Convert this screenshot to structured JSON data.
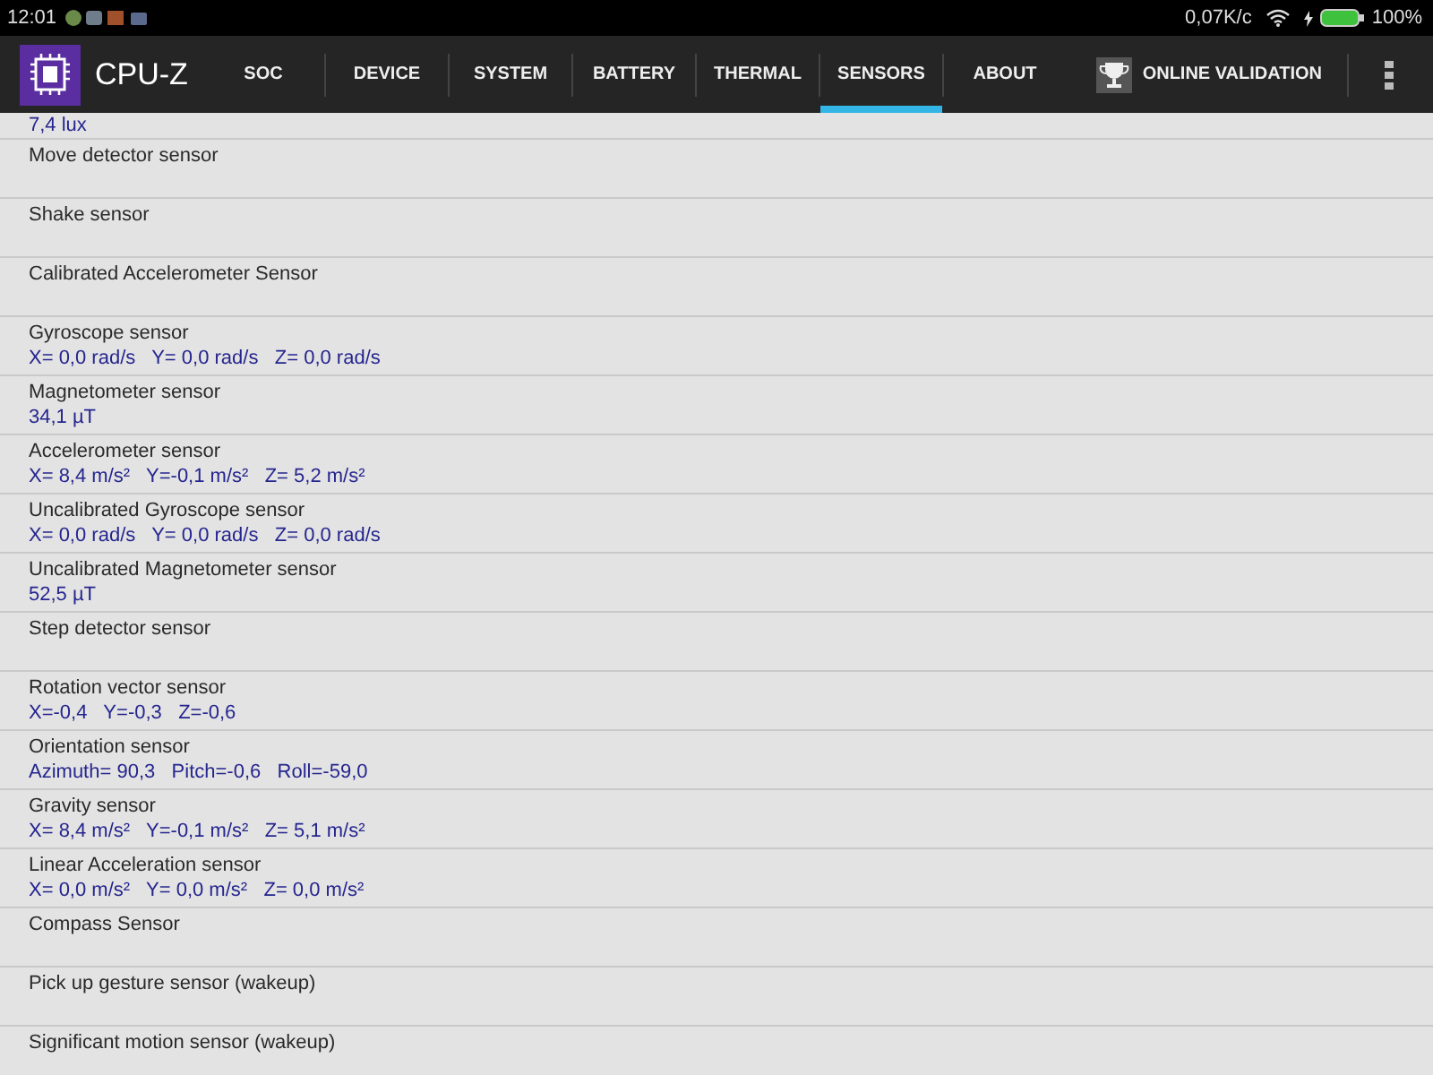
{
  "status_bar": {
    "time": "12:01",
    "speed": "0,07K/c",
    "battery": "100%"
  },
  "app_bar": {
    "title": "CPU-Z",
    "validation": "ONLINE VALIDATION"
  },
  "tabs": [
    {
      "label": "SOC",
      "selected": false
    },
    {
      "label": "DEVICE",
      "selected": false
    },
    {
      "label": "SYSTEM",
      "selected": false
    },
    {
      "label": "BATTERY",
      "selected": false
    },
    {
      "label": "THERMAL",
      "selected": false
    },
    {
      "label": "SENSORS",
      "selected": true
    },
    {
      "label": "ABOUT",
      "selected": false
    }
  ],
  "sensors": [
    {
      "value": "7,4 lux"
    },
    {
      "name": "Move detector sensor"
    },
    {
      "name": "Shake sensor"
    },
    {
      "name": "Calibrated Accelerometer Sensor"
    },
    {
      "name": "Gyroscope sensor",
      "value": "X= 0,0 rad/s   Y= 0,0 rad/s   Z= 0,0 rad/s"
    },
    {
      "name": "Magnetometer sensor",
      "value": "34,1 µT"
    },
    {
      "name": "Accelerometer sensor",
      "value": "X= 8,4 m/s²   Y=-0,1 m/s²   Z= 5,2 m/s²"
    },
    {
      "name": "Uncalibrated Gyroscope sensor",
      "value": "X= 0,0 rad/s   Y= 0,0 rad/s   Z= 0,0 rad/s"
    },
    {
      "name": "Uncalibrated Magnetometer sensor",
      "value": "52,5 µT"
    },
    {
      "name": "Step detector sensor"
    },
    {
      "name": "Rotation vector sensor",
      "value": "X=-0,4   Y=-0,3   Z=-0,6"
    },
    {
      "name": "Orientation sensor",
      "value": "Azimuth= 90,3   Pitch=-0,6   Roll=-59,0"
    },
    {
      "name": "Gravity sensor",
      "value": "X= 8,4 m/s²   Y=-0,1 m/s²   Z= 5,1 m/s²"
    },
    {
      "name": "Linear Acceleration sensor",
      "value": "X= 0,0 m/s²   Y= 0,0 m/s²   Z= 0,0 m/s²"
    },
    {
      "name": "Compass Sensor"
    },
    {
      "name": "Pick up gesture sensor (wakeup)"
    },
    {
      "name": "Significant motion sensor (wakeup)"
    }
  ]
}
